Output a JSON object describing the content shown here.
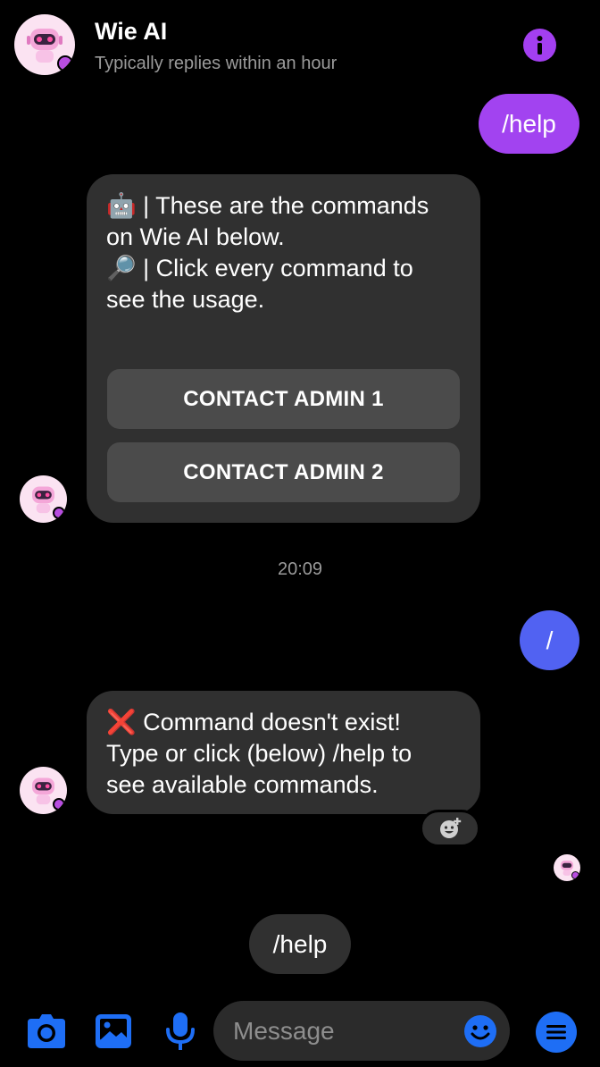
{
  "header": {
    "title": "Wie AI",
    "subtitle": "Typically replies within an hour",
    "avatar_icon": "robot-avatar-icon",
    "info_icon": "info-icon"
  },
  "messages": {
    "outgoing_help": "/help",
    "command_list": {
      "line1": "🤖 | These are the commands",
      "line2": "on Wie AI below.",
      "line3": "🔎 | Click every command to",
      "line4": "see the usage.",
      "buttons": [
        "CONTACT ADMIN 1",
        "CONTACT ADMIN 2"
      ]
    },
    "timestamp": "20:09",
    "outgoing_slash": "/",
    "error": {
      "line1": "❌ Command doesn't exist!",
      "line2": "Type or click (below) /help to",
      "line3": "see available commands."
    }
  },
  "quick_reply": "/help",
  "composer": {
    "placeholder": "Message",
    "icons": [
      "camera-icon",
      "image-icon",
      "microphone-icon",
      "emoji-icon",
      "menu-icon"
    ]
  },
  "colors": {
    "accent_purple": "#a243f0",
    "accent_blue": "#5162f2",
    "icon_blue": "#1e6ef5",
    "bubble_gray": "#303030"
  }
}
